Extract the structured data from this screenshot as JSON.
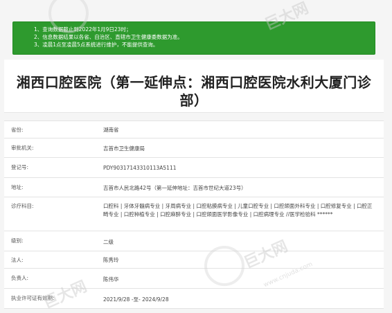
{
  "notice": {
    "lines": [
      "1、查询数据截止到2022年1月9日23时；",
      "2、信息数据结果以各省、自治区、直辖市卫生健康委数据为准。",
      "3、凌晨1点至凌晨5点系统进行维护，不能提供查询。"
    ]
  },
  "title": "湘西口腔医院（第一延伸点：湘西口腔医院水利大厦门诊部）",
  "details": [
    {
      "label": "省份:",
      "value": "湖南省"
    },
    {
      "label": "审批机关:",
      "value": "吉首市卫生健康局"
    },
    {
      "label": "登记号:",
      "value": "PDY90317143310113A5111"
    },
    {
      "label": "地址:",
      "value": "吉首市人民北路42号（第一延伸地址：吉首市世纪大道23号）"
    },
    {
      "label": "诊疗科目:",
      "value": "口腔科 | 牙体牙髓病专业 | 牙周病专业 | 口腔粘膜病专业 | 儿童口腔专业 | 口腔颌面外科专业 | 口腔修复专业 | 口腔正畸专业 | 口腔种植专业 | 口腔麻醉专业 | 口腔颌面医学影像专业 | 口腔病理专业 //医学检验科 ******"
    },
    {
      "label": "级别:",
      "value": "二级"
    },
    {
      "label": "法人:",
      "value": "陈秀玲"
    },
    {
      "label": "负责人:",
      "value": "陈伟华"
    },
    {
      "label": "执业许可证有效期:",
      "value": "2021/9/28 -至- 2024/9/28"
    }
  ],
  "watermark": {
    "brand": "巨大网",
    "url": "www.cnjuda.com"
  }
}
